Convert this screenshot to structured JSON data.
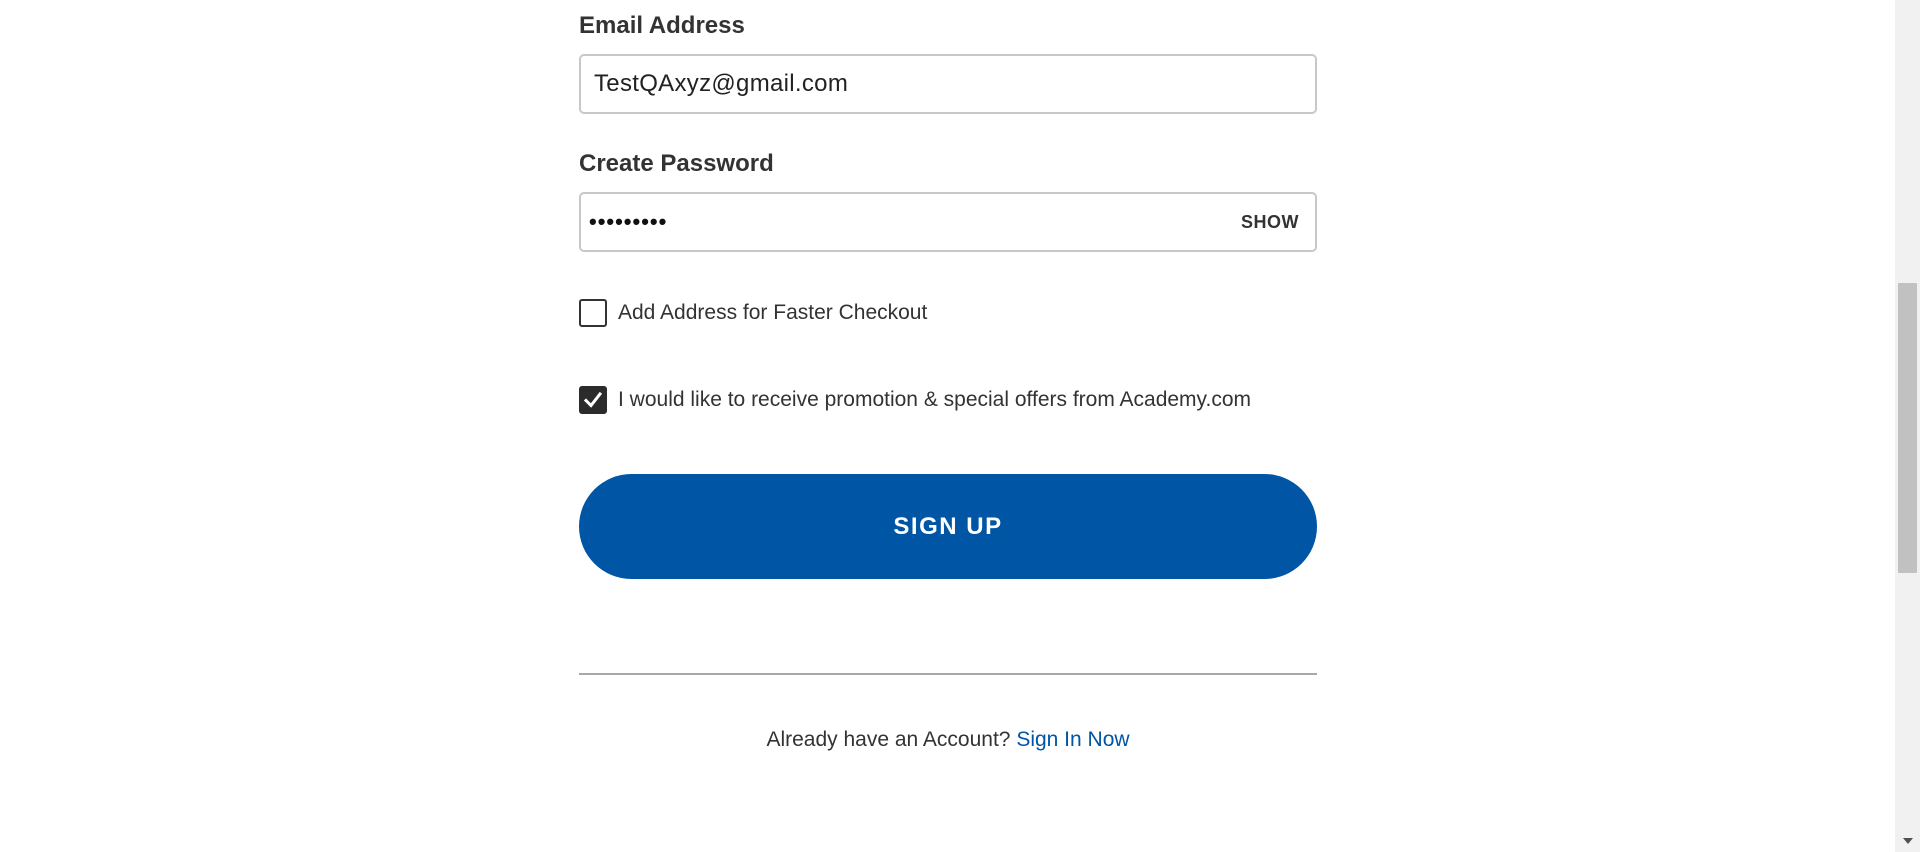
{
  "form": {
    "email": {
      "label": "Email Address",
      "value": "TestQAxyz@gmail.com"
    },
    "password": {
      "label": "Create Password",
      "masked_value": "•••••••••",
      "show_label": "SHOW"
    },
    "add_address": {
      "label": "Add Address for Faster Checkout",
      "checked": false
    },
    "promotions": {
      "label": "I would like to receive promotion & special offers from Academy.com",
      "checked": true
    },
    "submit_label": "SIGN UP"
  },
  "signin": {
    "prompt": "Already have an Account?",
    "link": "Sign In Now"
  },
  "colors": {
    "primary": "#0055a5",
    "text": "#333333",
    "checkbox_checked": "#2b2b2b"
  },
  "icons": {
    "checkmark": "check-icon",
    "scroll_down": "chevron-down-icon"
  }
}
